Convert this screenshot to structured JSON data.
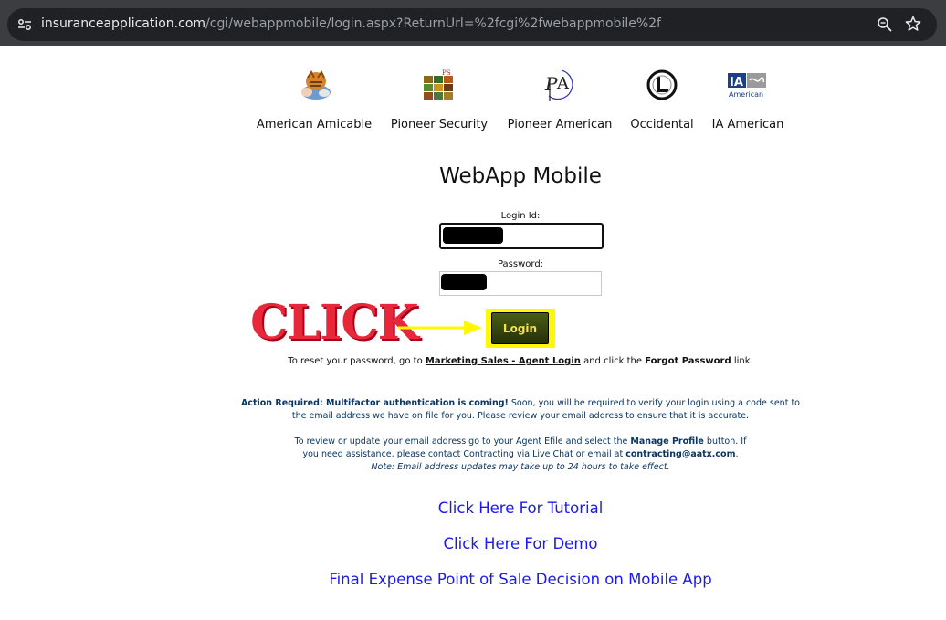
{
  "browser": {
    "url_domain": "insuranceapplication.com",
    "url_path": "/cgi/webappmobile/login.aspx?ReturnUrl=%2fcgi%2fwebappmobile%2f"
  },
  "companies": [
    {
      "name": "American Amicable",
      "logo": "tiger-logo"
    },
    {
      "name": "Pioneer Security",
      "logo": "ps-logo"
    },
    {
      "name": "Pioneer American",
      "logo": "pa-logo"
    },
    {
      "name": "Occidental",
      "logo": "occidental-logo"
    },
    {
      "name": "IA American",
      "logo": "ia-american-logo",
      "logo_text": "IA",
      "logo_subtext": "American"
    }
  ],
  "page_title": "WebApp Mobile",
  "form": {
    "login_label": "Login Id:",
    "password_label": "Password:",
    "login_button": "Login"
  },
  "annotation": {
    "click_text": "CLICK"
  },
  "reset": {
    "prefix": "To reset your password, go to",
    "link": "Marketing Sales - Agent Login",
    "middle": "and click the",
    "bold": "Forgot Password",
    "suffix": "link."
  },
  "notice": {
    "line1_bold": "Action Required: Multifactor authentication is coming!",
    "line1_rest": "Soon, you will be required to verify your login using a code sent to",
    "line2": "the email address we have on file for you. Please review your email address to ensure that it is accurate.",
    "line3_prefix": "To review or update your email address go to your Agent Efile and select the",
    "line3_bold": "Manage Profile",
    "line3_suffix": "button. If",
    "line4_prefix": "you need assistance, please contact Contracting via Live Chat or email at",
    "line4_bold": "contracting@aatx.com",
    "line4_suffix": ".",
    "line5": "Note: Email address updates may take up to 24 hours to take effect."
  },
  "links": {
    "tutorial": "Click Here For Tutorial",
    "demo": "Click Here For Demo",
    "final_expense": "Final Expense Point of Sale Decision on Mobile App"
  },
  "colors": {
    "click_red": "#e8283a",
    "arrow_yellow": "#fff800",
    "link_blue": "#1a1aee",
    "notice_navy": "#0b3560"
  }
}
